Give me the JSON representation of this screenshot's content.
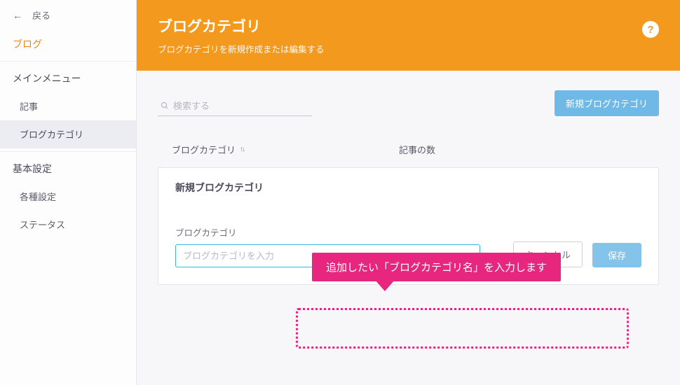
{
  "sidebar": {
    "back": "戻る",
    "top_active": "ブログ",
    "section1_label": "メインメニュー",
    "items1": [
      "記事",
      "ブログカテゴリ"
    ],
    "section2_label": "基本設定",
    "items2": [
      "各種設定",
      "ステータス"
    ]
  },
  "header": {
    "title": "ブログカテゴリ",
    "subtitle": "ブログカテゴリを新規作成または編集する",
    "help": "?"
  },
  "search": {
    "placeholder": "検索する"
  },
  "buttons": {
    "new_category": "新規ブログカテゴリ",
    "cancel": "キャンセル",
    "save": "保存"
  },
  "table": {
    "col_name": "ブログカテゴリ",
    "col_count": "記事の数"
  },
  "card": {
    "title": "新規ブログカテゴリ",
    "field_label": "ブログカテゴリ",
    "placeholder": "ブログカテゴリを入力"
  },
  "annotation": {
    "text": "追加したい「ブログカテゴリ名」を入力します"
  }
}
